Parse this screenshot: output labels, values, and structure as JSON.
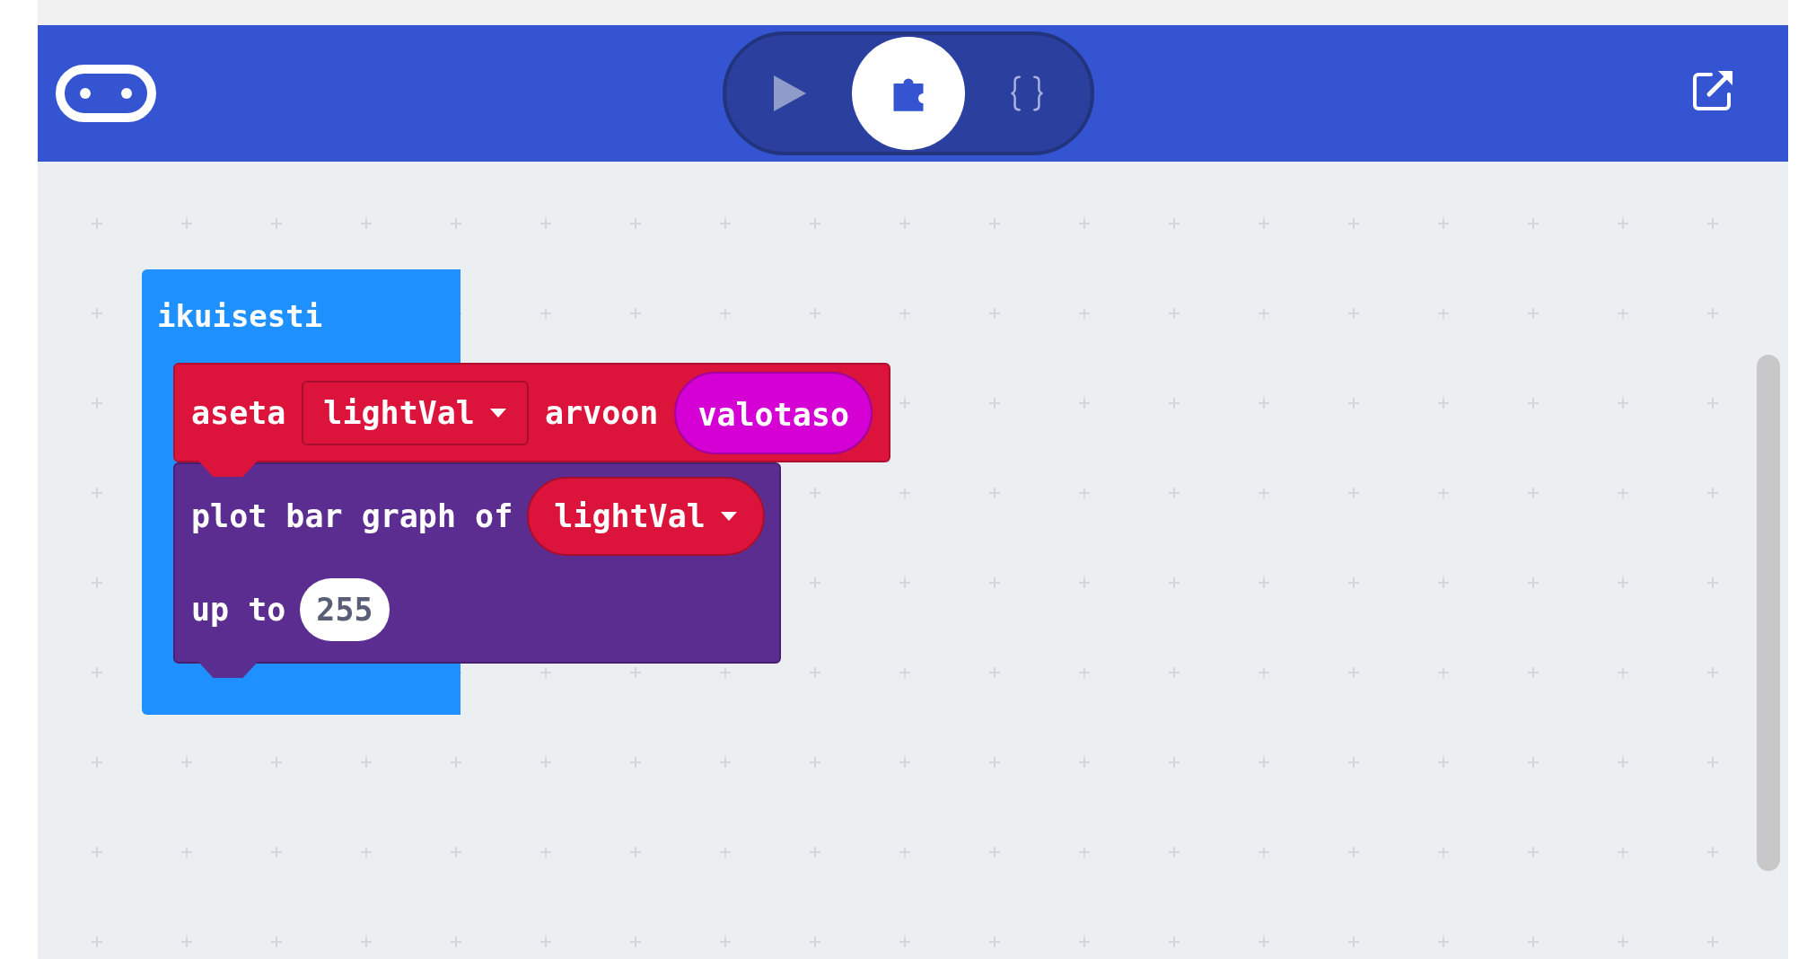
{
  "toolbar": {
    "modes": [
      {
        "kind": "simulator",
        "selected": false
      },
      {
        "kind": "blocks",
        "selected": true
      },
      {
        "kind": "javascript",
        "selected": false
      }
    ]
  },
  "workspace": {
    "blocks": [
      {
        "kind": "forever",
        "label": "ikuisesti",
        "children": [
          {
            "kind": "set",
            "color": "#dc143c",
            "lines": [
              [
                {
                  "kind": "text",
                  "text": "aseta"
                },
                {
                  "kind": "dropdown",
                  "text": "lightVal"
                },
                {
                  "kind": "text",
                  "text": "arvoon"
                },
                {
                  "kind": "reporter",
                  "text": "valotaso"
                }
              ]
            ]
          },
          {
            "kind": "plot",
            "color": "#5c2d91",
            "lines": [
              [
                {
                  "kind": "text",
                  "text": "plot bar graph of"
                },
                {
                  "kind": "variable",
                  "text": "lightVal"
                }
              ],
              [
                {
                  "kind": "text",
                  "text": "up to"
                },
                {
                  "kind": "number",
                  "text": "255"
                }
              ]
            ]
          }
        ]
      }
    ]
  }
}
